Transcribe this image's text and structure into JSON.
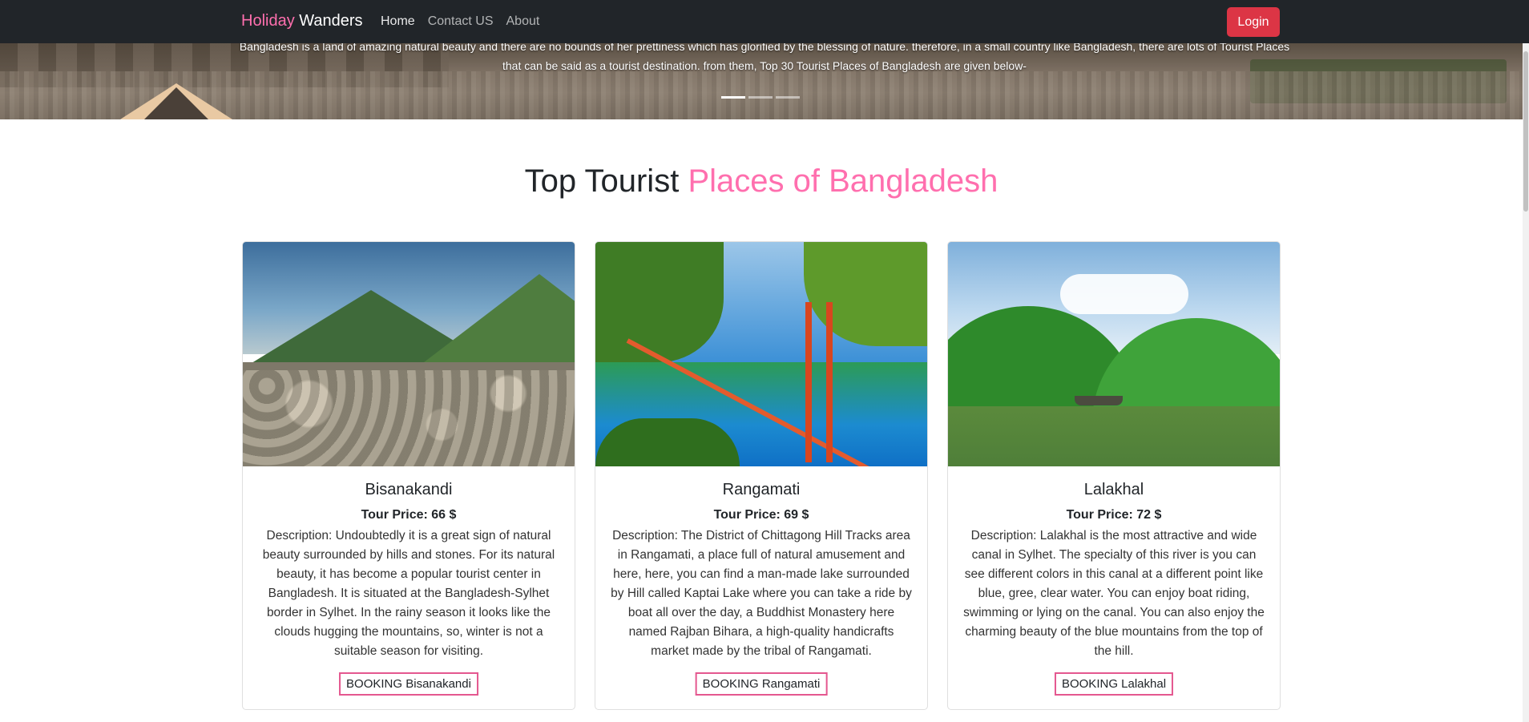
{
  "navbar": {
    "brand_part1": "Holiday",
    "brand_part2": "Wanders",
    "links": [
      "Home",
      "Contact US",
      "About"
    ],
    "login_label": "Login"
  },
  "hero": {
    "caption": "Bangladesh is a land of amazing natural beauty and there are no bounds of her prettiness which has glorified by the blessing of nature. therefore, in a small country like Bangladesh, there are lots of Tourist Places that can be said as a tourist destination. from them, Top 30 Tourist Places of Bangladesh are given below-"
  },
  "section": {
    "title_part1": "Top Tourist",
    "title_part2": "Places of Bangladesh"
  },
  "cards": [
    {
      "title": "Bisanakandi",
      "price": "Tour Price: 66 $",
      "description": "Description: Undoubtedly it is a great sign of natural beauty surrounded by hills and stones. For its natural beauty, it has become a popular tourist center in Bangladesh. It is situated at the Bangladesh-Sylhet border in Sylhet. In the rainy season it looks like the clouds hugging the mountains, so, winter is not a suitable season for visiting.",
      "button": "BOOKING Bisanakandi"
    },
    {
      "title": "Rangamati",
      "price": "Tour Price: 69 $",
      "description": "Description: The District of Chittagong Hill Tracks area in Rangamati, a place full of natural amusement and here, here, you can find a man-made lake surrounded by Hill called Kaptai Lake where you can take a ride by boat all over the day, a Buddhist Monastery here named Rajban Bihara, a high-quality handicrafts market made by the tribal of Rangamati.",
      "button": "BOOKING Rangamati"
    },
    {
      "title": "Lalakhal",
      "price": "Tour Price: 72 $",
      "description": "Description: Lalakhal is the most attractive and wide canal in Sylhet. The specialty of this river is you can see different colors in this canal at a different point like blue, gree, clear water. You can enjoy boat riding, swimming or lying on the canal. You can also enjoy the charming beauty of the blue mountains from the top of the hill.",
      "button": "BOOKING Lalakhal"
    }
  ],
  "colors": {
    "navbar_bg": "#212529",
    "accent_pink": "#ff6fae",
    "login_red": "#dc3545",
    "booking_border": "#e4578f"
  }
}
